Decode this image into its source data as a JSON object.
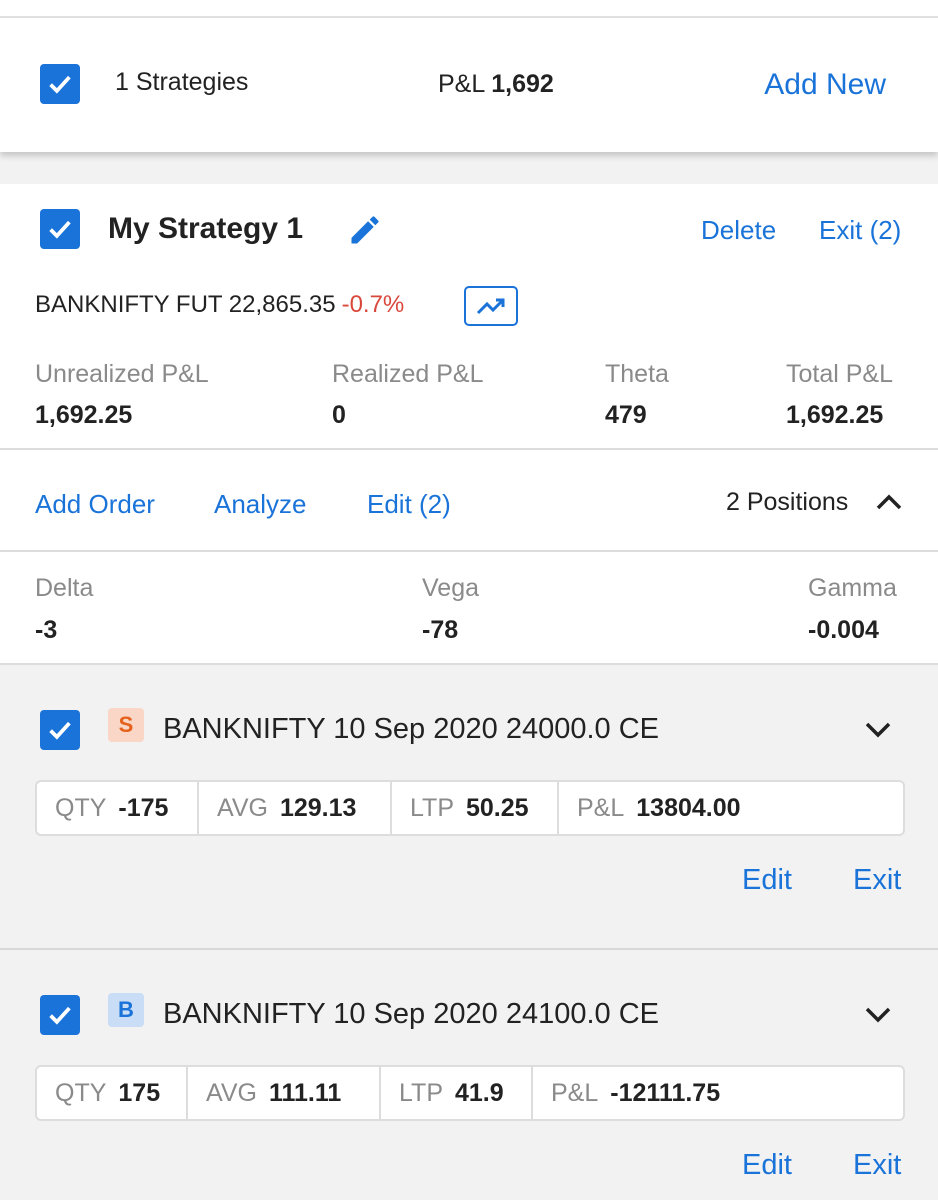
{
  "colors": {
    "accent": "#1a73d9",
    "negative": "#d9483b",
    "sell_badge": "#e5621c",
    "buy_badge": "#1a73d9"
  },
  "header": {
    "strategies_label": "1 Strategies",
    "pnl_label": "P&L",
    "pnl_value": "1,692",
    "add_new_label": "Add New",
    "select_all_checked": true
  },
  "strategy": {
    "checked": true,
    "name": "My Strategy 1",
    "delete_label": "Delete",
    "exit_label": "Exit (2)",
    "instrument": "BANKNIFTY FUT 22,865.35",
    "instrument_change": "-0.7%",
    "stats": [
      {
        "label": "Unrealized P&L",
        "value": "1,692.25"
      },
      {
        "label": "Realized P&L",
        "value": "0"
      },
      {
        "label": "Theta",
        "value": "479"
      },
      {
        "label": "Total P&L",
        "value": "1,692.25"
      }
    ],
    "actions": {
      "add_order": "Add Order",
      "analyze": "Analyze",
      "edit": "Edit (2)"
    },
    "positions_count": "2 Positions",
    "greeks": [
      {
        "label": "Delta",
        "value": "-3"
      },
      {
        "label": "Vega",
        "value": "-78"
      },
      {
        "label": "Gamma",
        "value": "-0.004"
      }
    ]
  },
  "positions": [
    {
      "checked": true,
      "side": "S",
      "title": "BANKNIFTY 10 Sep 2020 24000.0 CE",
      "cells": [
        {
          "k": "QTY",
          "v": "-175"
        },
        {
          "k": "AVG",
          "v": "129.13"
        },
        {
          "k": "LTP",
          "v": "50.25"
        },
        {
          "k": "P&L",
          "v": "13804.00"
        }
      ],
      "edit_label": "Edit",
      "exit_label": "Exit"
    },
    {
      "checked": true,
      "side": "B",
      "title": "BANKNIFTY 10 Sep 2020 24100.0 CE",
      "cells": [
        {
          "k": "QTY",
          "v": "175"
        },
        {
          "k": "AVG",
          "v": "111.11"
        },
        {
          "k": "LTP",
          "v": "41.9"
        },
        {
          "k": "P&L",
          "v": "-12111.75"
        }
      ],
      "edit_label": "Edit",
      "exit_label": "Exit"
    }
  ]
}
